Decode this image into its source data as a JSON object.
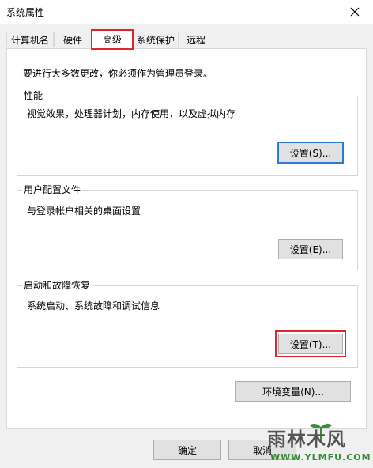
{
  "window": {
    "title": "系统属性"
  },
  "tabs": [
    {
      "label": "计算机名"
    },
    {
      "label": "硬件"
    },
    {
      "label": "高级"
    },
    {
      "label": "系统保护"
    },
    {
      "label": "远程"
    }
  ],
  "advanced": {
    "intro": "要进行大多数更改，你必须作为管理员登录。",
    "performance": {
      "title": "性能",
      "description": "视觉效果，处理器计划，内存使用，以及虚拟内存",
      "button": "设置(S)..."
    },
    "user_profiles": {
      "title": "用户配置文件",
      "description": "与登录帐户相关的桌面设置",
      "button": "设置(E)..."
    },
    "startup_recovery": {
      "title": "启动和故障恢复",
      "description": "系统启动、系统故障和调试信息",
      "button": "设置(T)..."
    },
    "env_vars_button": "环境变量(N)..."
  },
  "footer": {
    "ok": "确定",
    "cancel": "取消"
  },
  "watermark": {
    "main": "雨林木风",
    "sub": "WWW.YLMFU.COM"
  },
  "colors": {
    "highlight": "#e0262d",
    "focus": "#2a7ad6"
  }
}
